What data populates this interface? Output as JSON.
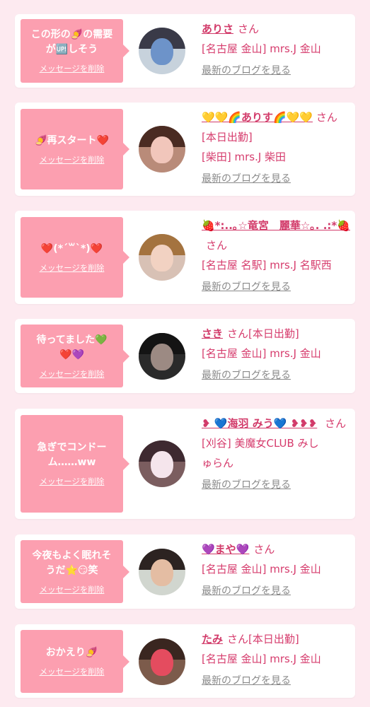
{
  "delete_label": "メッセージを削除",
  "blog_label": "最新のブログを見る",
  "entries": [
    {
      "message": "この形の🍠の需要\nが🆙しそう",
      "name": "ありさ",
      "suffix": "さん",
      "shop": "[名古屋 金山] mrs.J 金山",
      "avatar": {
        "bg": "#c7d2dc",
        "hair": "#3a3a48",
        "face": "#6d93c9"
      }
    },
    {
      "message": "🍠再スタート❤️",
      "name": "💛💛🌈ありす🌈💛💛",
      "suffix": "さん[本日出勤]",
      "shop": "[柴田] mrs.J 柴田",
      "avatar": {
        "bg": "#b98b79",
        "hair": "#4a2b22",
        "face": "#f1c6bb"
      }
    },
    {
      "message": "❤️(*´꒳`*)❤️",
      "name": "🍓*:..｡☆竜宮　麗華☆｡. .:*🍓",
      "suffix": "さん",
      "shop": "[名古屋 名駅] mrs.J 名駅西",
      "avatar": {
        "bg": "#d8c1b5",
        "hair": "#a4733f",
        "face": "#f2d2c2"
      }
    },
    {
      "message": "待ってました💚\n❤️💜",
      "name": "さき",
      "suffix": "さん[本日出勤]",
      "shop": "[名古屋 金山] mrs.J 金山",
      "avatar": {
        "bg": "#2a2a2a",
        "hair": "#141414",
        "face": "#9c8a83"
      }
    },
    {
      "message": "急ぎでコンドー\nム……ww",
      "name": "❥ 💙海羽 みう💙 ❥❥❥",
      "suffix": "さん",
      "shop": "[刈谷] 美魔女CLUB みしゅらん",
      "avatar": {
        "bg": "#7b5d5f",
        "hair": "#3e2930",
        "face": "#f5e5ec"
      }
    },
    {
      "message": "今夜もよく眠れそ\nうだ⭐️😏笑",
      "name": "💜まや💜",
      "suffix": "さん",
      "shop": "[名古屋 金山] mrs.J 金山",
      "avatar": {
        "bg": "#d1d6cf",
        "hair": "#2c2321",
        "face": "#e4bda3"
      }
    },
    {
      "message": "おかえり🍠",
      "name": "たみ",
      "suffix": "さん[本日出勤]",
      "shop": "[名古屋 金山] mrs.J 金山",
      "avatar": {
        "bg": "#7c5b4b",
        "hair": "#3a2620",
        "face": "#e44c5f"
      }
    }
  ]
}
